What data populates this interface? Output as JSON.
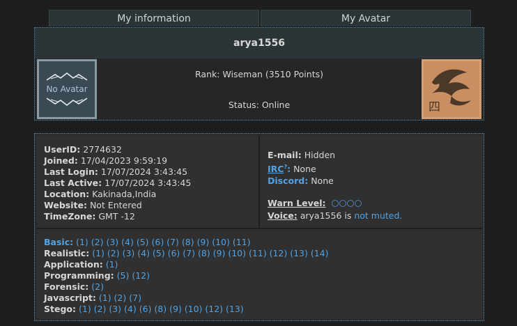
{
  "tabs": [
    "My information",
    "My Avatar"
  ],
  "profile": {
    "username": "arya1556",
    "rank": "Rank: Wiseman (3510 Points)",
    "status": "Status: Online",
    "no_avatar_text": "No Avatar",
    "avatar_glyph": "四"
  },
  "details": {
    "userid_label": "UserID:",
    "userid": "2774632",
    "joined_label": "Joined:",
    "joined": "17/04/2023 9:59:19",
    "lastlogin_label": "Last Login:",
    "lastlogin": "17/07/2024 3:43:45",
    "lastactive_label": "Last Active:",
    "lastactive": "17/07/2024 3:43:45",
    "location_label": "Location:",
    "location": "Kakinada,India",
    "website_label": "Website:",
    "website": "Not Entered",
    "timezone_label": "TimeZone:",
    "timezone": "GMT -12"
  },
  "contact": {
    "email_label": "E-mail:",
    "email": "Hidden",
    "irc_label": "IRC",
    "irc_sup": "?",
    "irc_sep": ":",
    "irc": "None",
    "discord_label": "Discord:",
    "discord": "None",
    "warn_label": "Warn Level:",
    "warn_level": 0,
    "voice_label": "Voice:",
    "voice_text": "arya1556 is",
    "voice_link": "not muted."
  },
  "challenges": {
    "basic_label": "Basic:",
    "basic": "(1) (2) (3) (4) (5) (6) (7) (8) (9) (10) (11)",
    "realistic_label": "Realistic:",
    "realistic": "(1) (2) (3) (4) (5) (6) (7) (8) (9) (10) (11) (12) (13) (14)",
    "application_label": "Application:",
    "application": "(1)",
    "programming_label": "Programming:",
    "programming": "(5) (12)",
    "forensic_label": "Forensic:",
    "forensic": "(2)",
    "javascript_label": "Javascript:",
    "javascript": "(1) (2) (7)",
    "stego_label": "Stego:",
    "stego": "(1) (2) (3) (4) (6) (8) (9) (10) (12) (13)"
  },
  "colors": {
    "accent": "#4fa3e6",
    "panel": "#303030",
    "header": "#2b3437",
    "avatar": "#d59f73"
  }
}
